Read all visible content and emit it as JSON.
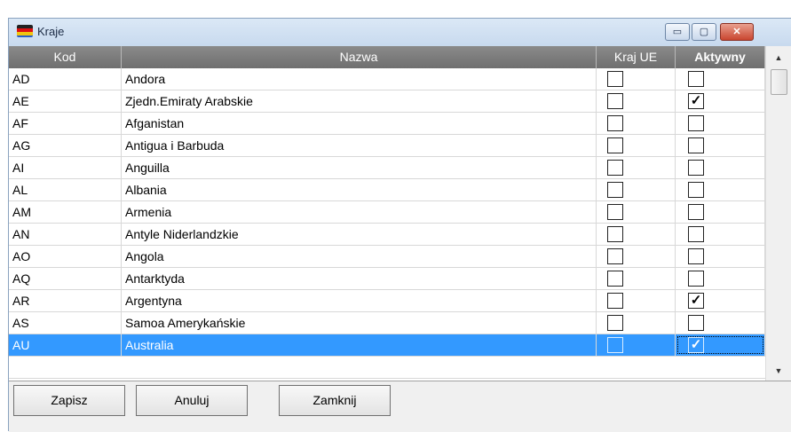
{
  "window": {
    "title": "Kraje",
    "minimize": "▭",
    "maximize": "▢",
    "close": "✕"
  },
  "columns": {
    "kod": "Kod",
    "nazwa": "Nazwa",
    "kraj_ue": "Kraj UE",
    "aktywny": "Aktywny"
  },
  "rows": [
    {
      "kod": "AD",
      "nazwa": "Andora",
      "kraj_ue": false,
      "aktywny": false
    },
    {
      "kod": "AE",
      "nazwa": "Zjedn.Emiraty Arabskie",
      "kraj_ue": false,
      "aktywny": true
    },
    {
      "kod": "AF",
      "nazwa": "Afganistan",
      "kraj_ue": false,
      "aktywny": false
    },
    {
      "kod": "AG",
      "nazwa": "Antigua i Barbuda",
      "kraj_ue": false,
      "aktywny": false
    },
    {
      "kod": "AI",
      "nazwa": "Anguilla",
      "kraj_ue": false,
      "aktywny": false
    },
    {
      "kod": "AL",
      "nazwa": "Albania",
      "kraj_ue": false,
      "aktywny": false
    },
    {
      "kod": "AM",
      "nazwa": "Armenia",
      "kraj_ue": false,
      "aktywny": false
    },
    {
      "kod": "AN",
      "nazwa": "Antyle Niderlandzkie",
      "kraj_ue": false,
      "aktywny": false
    },
    {
      "kod": "AO",
      "nazwa": "Angola",
      "kraj_ue": false,
      "aktywny": false
    },
    {
      "kod": "AQ",
      "nazwa": "Antarktyda",
      "kraj_ue": false,
      "aktywny": false
    },
    {
      "kod": "AR",
      "nazwa": "Argentyna",
      "kraj_ue": false,
      "aktywny": true
    },
    {
      "kod": "AS",
      "nazwa": "Samoa Amerykańskie",
      "kraj_ue": false,
      "aktywny": false
    },
    {
      "kod": "AU",
      "nazwa": "Australia",
      "kraj_ue": false,
      "aktywny": true,
      "selected": true
    }
  ],
  "buttons": {
    "zapisz": "Zapisz",
    "anuluj": "Anuluj",
    "zamknij": "Zamknij"
  },
  "check_mark": "✓",
  "scroll": {
    "up": "▲",
    "down": "▼"
  },
  "colors": {
    "selection": "#3399ff",
    "header": "#7d7d7d"
  }
}
